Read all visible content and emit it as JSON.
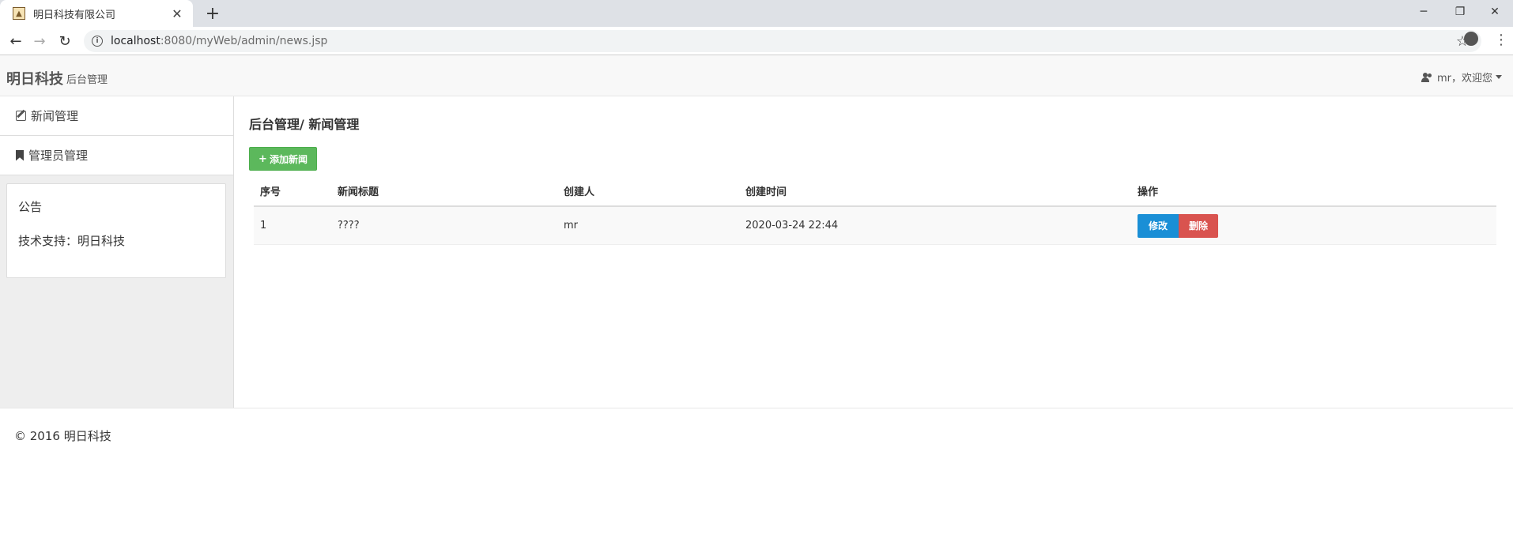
{
  "browser": {
    "tab_title": "明日科技有限公司",
    "tab_close": "✕",
    "new_tab": "+",
    "url_host": "localhost",
    "url_path": ":8080/myWeb/admin/news.jsp"
  },
  "header": {
    "brand": "明日科技",
    "brand_sub": "后台管理",
    "user_greeting": "mr，欢迎您"
  },
  "sidebar": {
    "items": [
      {
        "label": "新闻管理",
        "icon": "edit-icon"
      },
      {
        "label": "管理员管理",
        "icon": "bookmark-icon"
      }
    ],
    "notice": {
      "title": "公告",
      "text": "技术支持：明日科技"
    }
  },
  "main": {
    "title": "后台管理/ 新闻管理",
    "add_button": "添加新闻",
    "table": {
      "headers": [
        "序号",
        "新闻标题",
        "创建人",
        "创建时间",
        "操作"
      ],
      "rows": [
        {
          "index": "1",
          "title": "????",
          "creator": "mr",
          "created": "2020-03-24 22:44"
        }
      ],
      "edit_label": "修改",
      "delete_label": "删除"
    }
  },
  "footer": {
    "text": "© 2016 明日科技"
  },
  "colors": {
    "add_button": "#5cb85c",
    "edit_button": "#1a8fd6",
    "delete_button": "#d9534f"
  }
}
